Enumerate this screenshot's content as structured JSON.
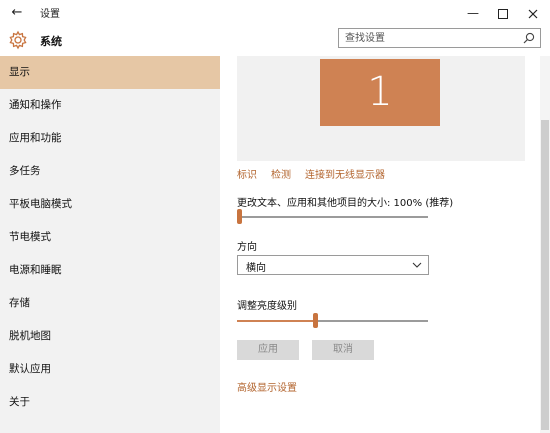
{
  "window": {
    "back_glyph": "←",
    "title": "设置",
    "minimize_glyph": "—"
  },
  "header": {
    "title": "系统",
    "search_placeholder": "查找设置",
    "icon": "gear-icon"
  },
  "sidebar": {
    "items": [
      {
        "label": "显示",
        "active": true
      },
      {
        "label": "通知和操作"
      },
      {
        "label": "应用和功能"
      },
      {
        "label": "多任务"
      },
      {
        "label": "平板电脑模式"
      },
      {
        "label": "节电模式"
      },
      {
        "label": "电源和睡眠"
      },
      {
        "label": "存储"
      },
      {
        "label": "脱机地图"
      },
      {
        "label": "默认应用"
      },
      {
        "label": "关于"
      }
    ]
  },
  "display": {
    "monitor_number": "1",
    "links": {
      "identify": "标识",
      "detect": "检测",
      "wireless": "连接到无线显示器"
    },
    "scale_label": "更改文本、应用和其他项目的大小: 100% (推荐)",
    "scale_slider_level": 0,
    "orientation_label": "方向",
    "orientation_value": "横向",
    "brightness_label": "调整亮度级别",
    "brightness_level": 0.41,
    "apply_label": "应用",
    "cancel_label": "取消",
    "advanced_link": "高级显示设置"
  },
  "colors": {
    "accent": "#cf8253",
    "active_nav": "#e6c7a5",
    "link": "#b3652f"
  }
}
